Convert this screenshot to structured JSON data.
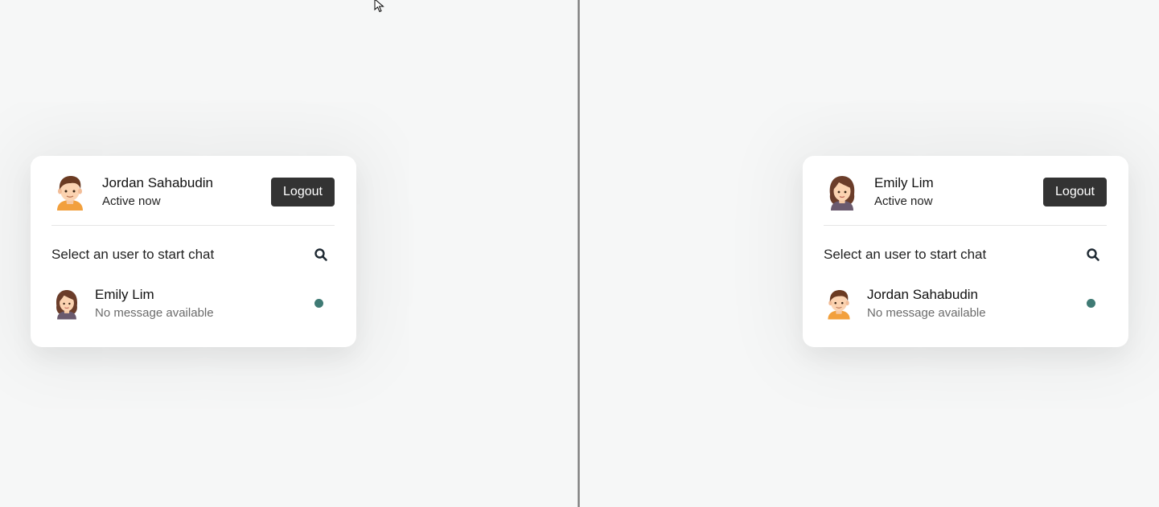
{
  "colors": {
    "background": "#f6f7f7",
    "card": "#ffffff",
    "button": "#333333",
    "online_dot": "#3f7a74"
  },
  "panes": [
    {
      "me": {
        "name": "Jordan Sahabudin",
        "status": "Active now",
        "avatar_icon": "male-avatar-icon"
      },
      "logout_label": "Logout",
      "search": {
        "text": "Select an user to start chat",
        "icon": "search-icon"
      },
      "users": [
        {
          "name": "Emily Lim",
          "message": "No message available",
          "avatar_icon": "female-avatar-icon",
          "status": "online"
        }
      ]
    },
    {
      "me": {
        "name": "Emily Lim",
        "status": "Active now",
        "avatar_icon": "female-avatar-icon"
      },
      "logout_label": "Logout",
      "search": {
        "text": "Select an user to start chat",
        "icon": "search-icon"
      },
      "users": [
        {
          "name": "Jordan Sahabudin",
          "message": "No message available",
          "avatar_icon": "male-avatar-icon",
          "status": "online"
        }
      ]
    }
  ]
}
